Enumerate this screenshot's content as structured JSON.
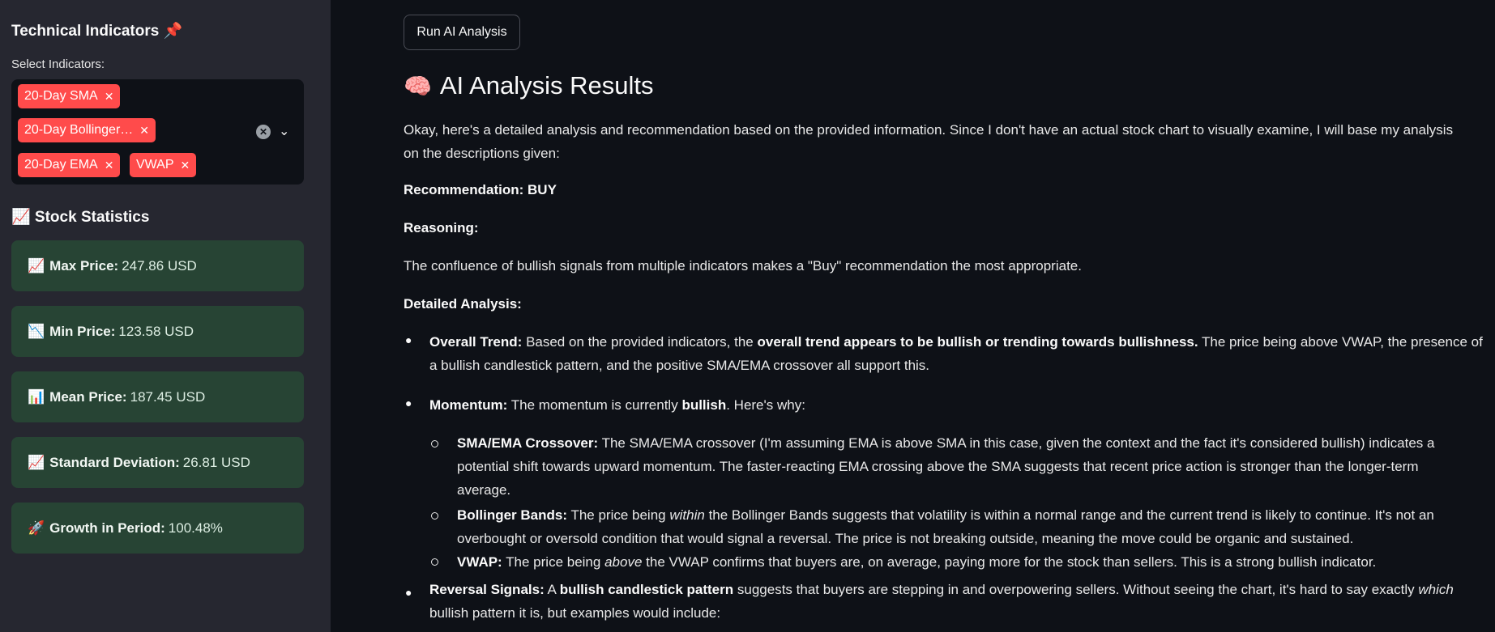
{
  "sidebar": {
    "title": "Technical Indicators 📌",
    "select_label": "Select Indicators:",
    "chips": [
      "20-Day SMA",
      "20-Day Bollinger…",
      "20-Day EMA",
      "VWAP"
    ],
    "chip_remove": "✕",
    "section_title": "📈 Stock Statistics",
    "stats": [
      {
        "icon": "📈",
        "label": "Max Price:",
        "value": "247.86 USD"
      },
      {
        "icon": "📉",
        "label": "Min Price:",
        "value": "123.58 USD"
      },
      {
        "icon": "📊",
        "label": "Mean Price:",
        "value": "187.45 USD"
      },
      {
        "icon": "📈",
        "label": "Standard Deviation:",
        "value": "26.81 USD"
      },
      {
        "icon": "🚀",
        "label": "Growth in Period:",
        "value": "100.48%"
      }
    ]
  },
  "main": {
    "run_button": "Run AI Analysis",
    "heading_icon": "🧠",
    "heading": "AI Analysis Results",
    "intro_1": "Okay, here's a detailed analysis and recommendation based on the provided information. Since I don't have an actual stock chart to visually examine, I will base my analysis",
    "intro_2": "on the descriptions given:",
    "recommendation": "Recommendation: BUY",
    "reasoning_label": "Reasoning:",
    "reasoning": "The confluence of bullish signals from multiple indicators makes a \"Buy\" recommendation the most appropriate.",
    "detailed_label": "Detailed Analysis:",
    "trend_label": "Overall Trend:",
    "trend_pre": "Based on the provided indicators, the",
    "trend_bold": "overall trend appears to be bullish or trending towards bullishness.",
    "trend_post": "The price being above VWAP, the presence of",
    "trend_2": "a bullish candlestick pattern, and the positive SMA/EMA crossover all support this.",
    "momentum_label": "Momentum:",
    "momentum_pre": "The momentum is currently",
    "momentum_bold": "bullish",
    "momentum_post": ". Here's why:",
    "sma_label": "SMA/EMA Crossover:",
    "sma_1": "The SMA/EMA crossover (I'm assuming EMA is above SMA in this case, given the context and the fact it's considered bullish) indicates a",
    "sma_2": "potential shift towards upward momentum. The faster-reacting EMA crossing above the SMA suggests that recent price action is stronger than the longer-term",
    "sma_3": "average.",
    "bb_label": "Bollinger Bands:",
    "bb_pre": "The price being",
    "bb_em": "within",
    "bb_post": "the Bollinger Bands suggests that volatility is within a normal range and the current trend is likely to continue. It's not an",
    "bb_2": "overbought or oversold condition that would signal a reversal. The price is not breaking outside, meaning the move could be organic and sustained.",
    "vwap_label": "VWAP:",
    "vwap_pre": "The price being",
    "vwap_em": "above",
    "vwap_post": "the VWAP confirms that buyers are, on average, paying more for the stock than sellers. This is a strong bullish indicator.",
    "rev_label": "Reversal Signals:",
    "rev_pre": "A",
    "rev_bold": "bullish candlestick pattern",
    "rev_mid": "suggests that buyers are stepping in and overpowering sellers. Without seeing the chart, it's hard to say exactly",
    "rev_em": "which",
    "rev_2": "bullish pattern it is, but examples would include:"
  },
  "colors": {
    "chip": "#ff4b4b",
    "stat_bg": "#274434",
    "sidebar_bg": "#262730",
    "main_bg": "#0e1117"
  }
}
